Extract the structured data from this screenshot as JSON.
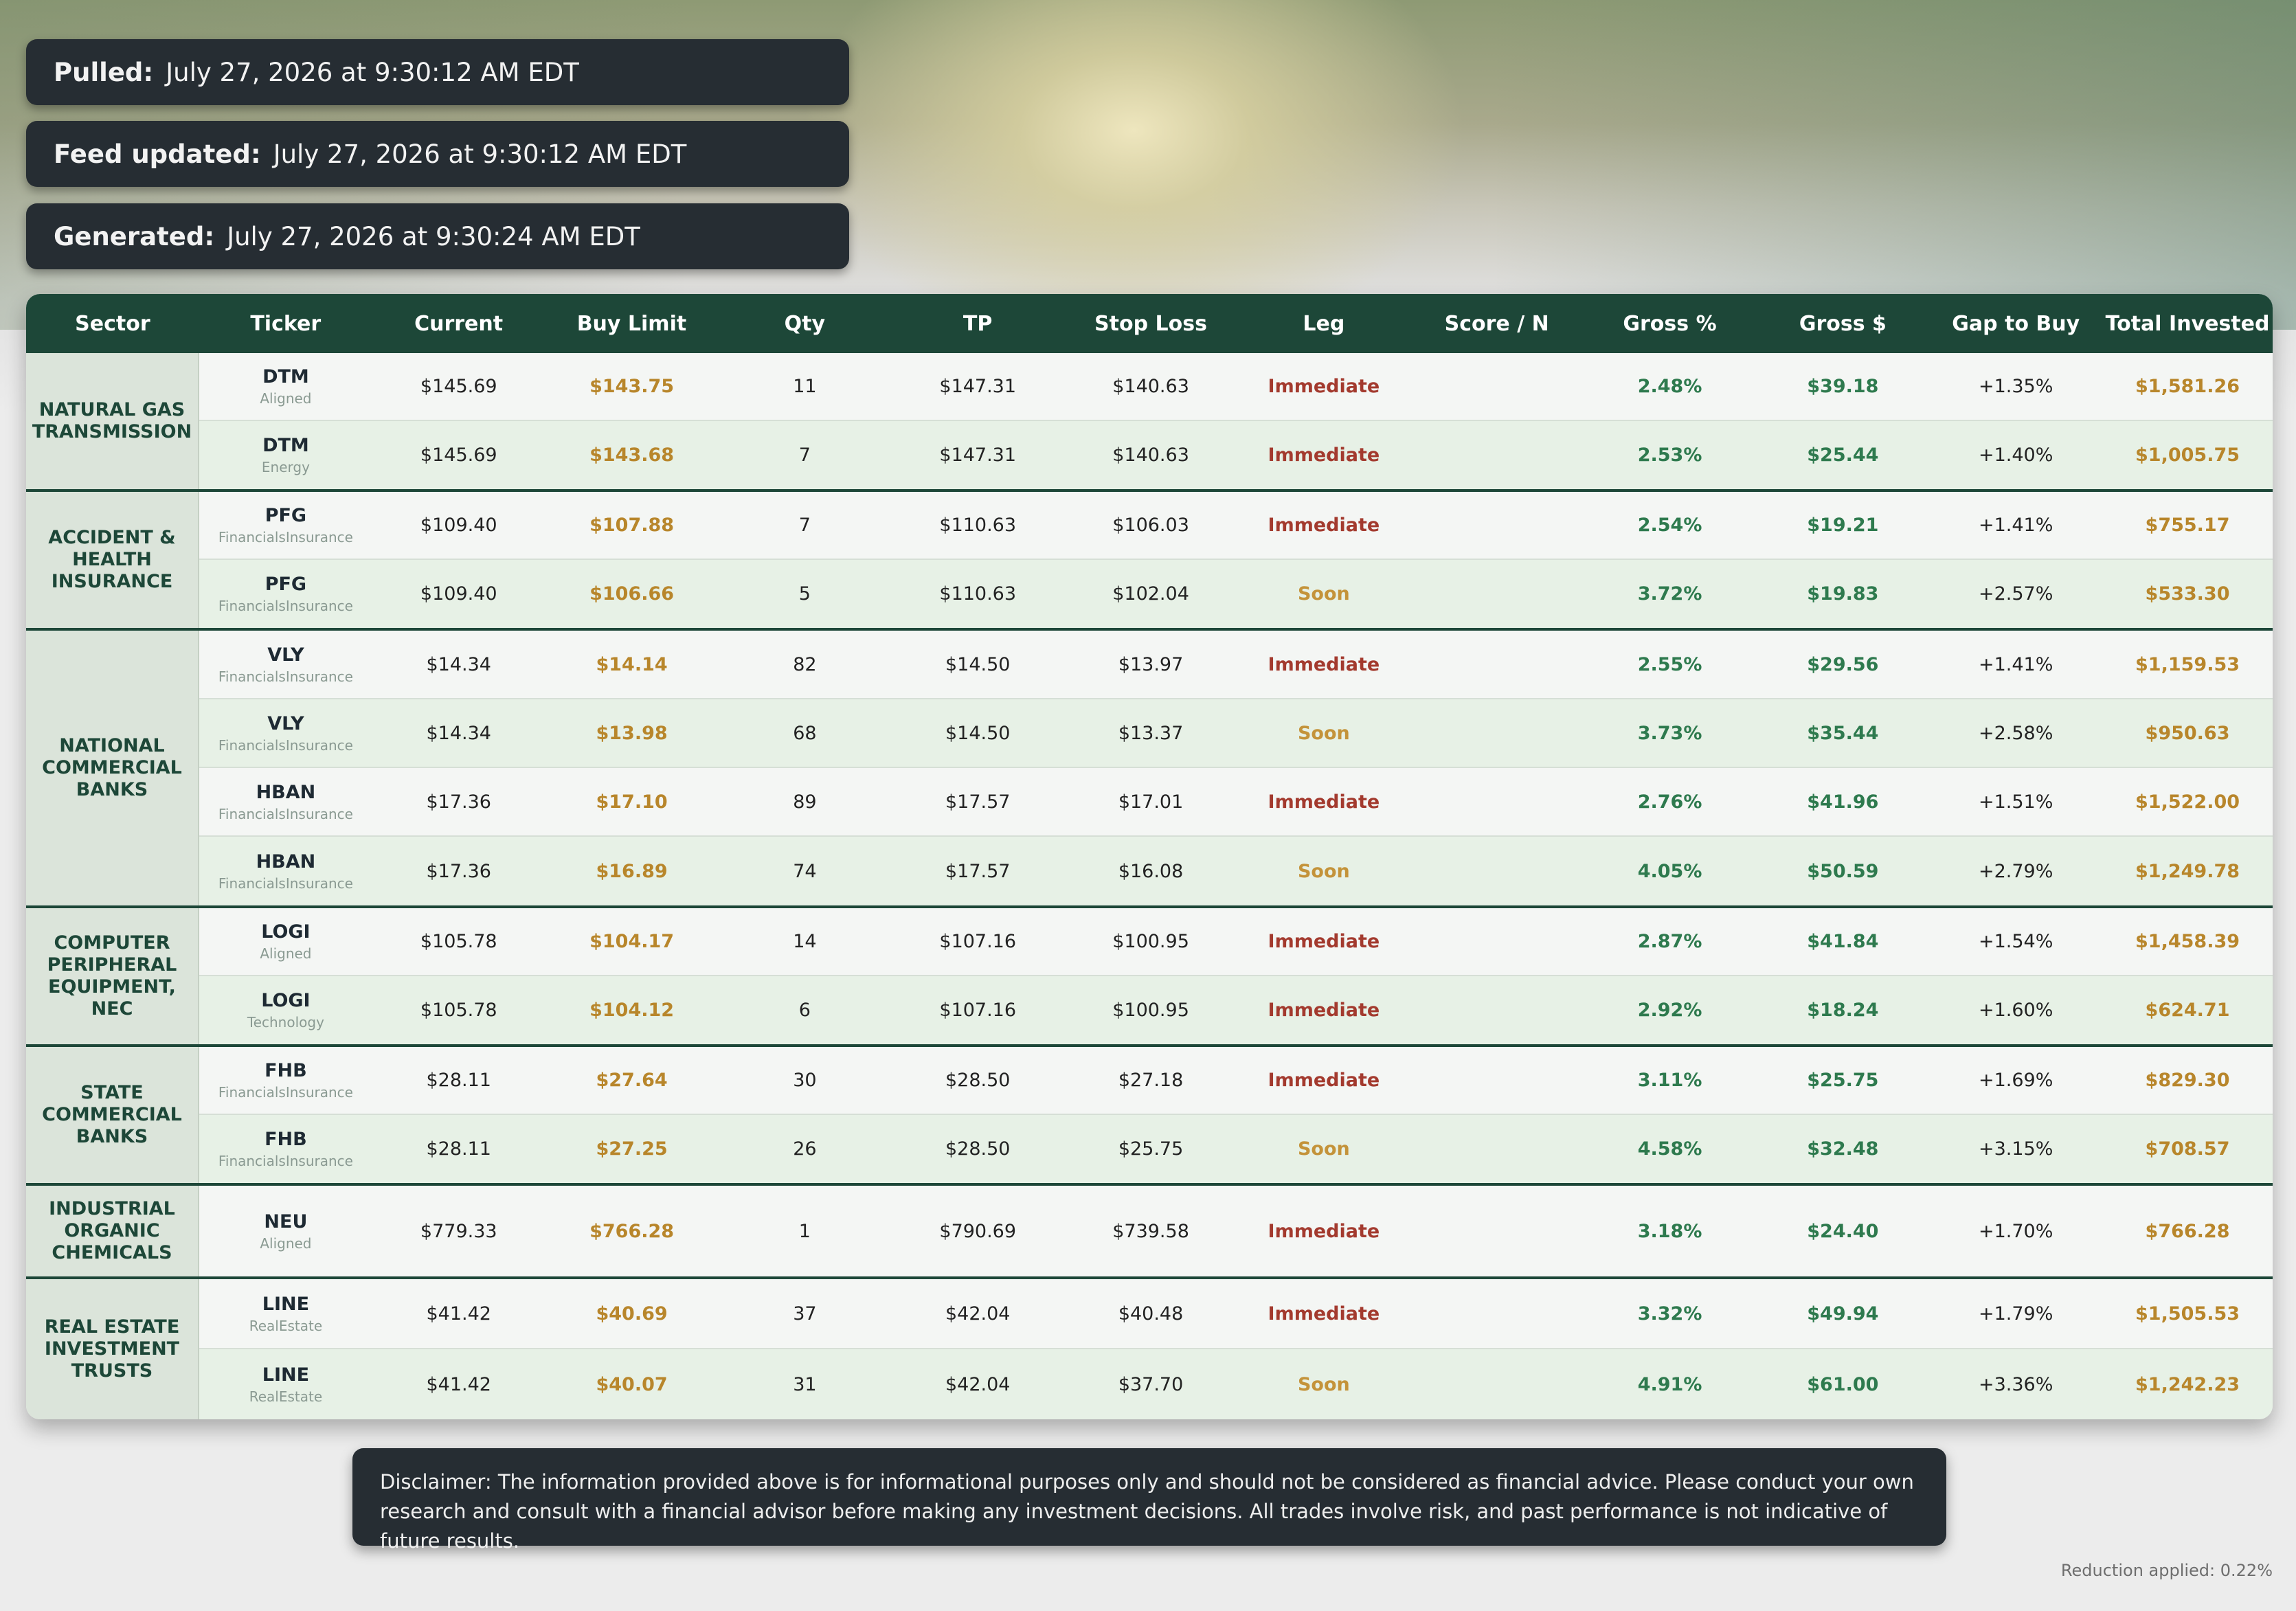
{
  "header": {
    "pulled_label": "Pulled:",
    "pulled_value": "July 27, 2026 at 9:30:12 AM EDT",
    "feed_label": "Feed updated:",
    "feed_value": "July 27, 2026 at 9:30:12 AM EDT",
    "generated_label": "Generated:",
    "generated_value": "July 27, 2026 at 9:30:24 AM EDT"
  },
  "table": {
    "columns": [
      "Sector",
      "Ticker",
      "Current",
      "Buy Limit",
      "Qty",
      "TP",
      "Stop Loss",
      "Leg",
      "Score / N",
      "Gross %",
      "Gross $",
      "Gap to Buy",
      "Total Invested"
    ],
    "groups": [
      {
        "sector": "NATURAL GAS TRANSMISSION",
        "rows": [
          {
            "ticker": "DTM",
            "sub": "Aligned",
            "current": "$145.69",
            "buy_limit": "$143.75",
            "qty": "11",
            "tp": "$147.31",
            "stop_loss": "$140.63",
            "leg": "Immediate",
            "score": "",
            "gross_pct": "2.48%",
            "gross_usd": "$39.18",
            "gap": "+1.35%",
            "total": "$1,581.26"
          },
          {
            "ticker": "DTM",
            "sub": "Energy",
            "current": "$145.69",
            "buy_limit": "$143.68",
            "qty": "7",
            "tp": "$147.31",
            "stop_loss": "$140.63",
            "leg": "Immediate",
            "score": "",
            "gross_pct": "2.53%",
            "gross_usd": "$25.44",
            "gap": "+1.40%",
            "total": "$1,005.75"
          }
        ]
      },
      {
        "sector": "ACCIDENT & HEALTH INSURANCE",
        "rows": [
          {
            "ticker": "PFG",
            "sub": "FinancialsInsurance",
            "current": "$109.40",
            "buy_limit": "$107.88",
            "qty": "7",
            "tp": "$110.63",
            "stop_loss": "$106.03",
            "leg": "Immediate",
            "score": "",
            "gross_pct": "2.54%",
            "gross_usd": "$19.21",
            "gap": "+1.41%",
            "total": "$755.17"
          },
          {
            "ticker": "PFG",
            "sub": "FinancialsInsurance",
            "current": "$109.40",
            "buy_limit": "$106.66",
            "qty": "5",
            "tp": "$110.63",
            "stop_loss": "$102.04",
            "leg": "Soon",
            "score": "",
            "gross_pct": "3.72%",
            "gross_usd": "$19.83",
            "gap": "+2.57%",
            "total": "$533.30"
          }
        ]
      },
      {
        "sector": "NATIONAL COMMERCIAL BANKS",
        "rows": [
          {
            "ticker": "VLY",
            "sub": "FinancialsInsurance",
            "current": "$14.34",
            "buy_limit": "$14.14",
            "qty": "82",
            "tp": "$14.50",
            "stop_loss": "$13.97",
            "leg": "Immediate",
            "score": "",
            "gross_pct": "2.55%",
            "gross_usd": "$29.56",
            "gap": "+1.41%",
            "total": "$1,159.53"
          },
          {
            "ticker": "VLY",
            "sub": "FinancialsInsurance",
            "current": "$14.34",
            "buy_limit": "$13.98",
            "qty": "68",
            "tp": "$14.50",
            "stop_loss": "$13.37",
            "leg": "Soon",
            "score": "",
            "gross_pct": "3.73%",
            "gross_usd": "$35.44",
            "gap": "+2.58%",
            "total": "$950.63"
          },
          {
            "ticker": "HBAN",
            "sub": "FinancialsInsurance",
            "current": "$17.36",
            "buy_limit": "$17.10",
            "qty": "89",
            "tp": "$17.57",
            "stop_loss": "$17.01",
            "leg": "Immediate",
            "score": "",
            "gross_pct": "2.76%",
            "gross_usd": "$41.96",
            "gap": "+1.51%",
            "total": "$1,522.00"
          },
          {
            "ticker": "HBAN",
            "sub": "FinancialsInsurance",
            "current": "$17.36",
            "buy_limit": "$16.89",
            "qty": "74",
            "tp": "$17.57",
            "stop_loss": "$16.08",
            "leg": "Soon",
            "score": "",
            "gross_pct": "4.05%",
            "gross_usd": "$50.59",
            "gap": "+2.79%",
            "total": "$1,249.78"
          }
        ]
      },
      {
        "sector": "COMPUTER PERIPHERAL EQUIPMENT, NEC",
        "rows": [
          {
            "ticker": "LOGI",
            "sub": "Aligned",
            "current": "$105.78",
            "buy_limit": "$104.17",
            "qty": "14",
            "tp": "$107.16",
            "stop_loss": "$100.95",
            "leg": "Immediate",
            "score": "",
            "gross_pct": "2.87%",
            "gross_usd": "$41.84",
            "gap": "+1.54%",
            "total": "$1,458.39"
          },
          {
            "ticker": "LOGI",
            "sub": "Technology",
            "current": "$105.78",
            "buy_limit": "$104.12",
            "qty": "6",
            "tp": "$107.16",
            "stop_loss": "$100.95",
            "leg": "Immediate",
            "score": "",
            "gross_pct": "2.92%",
            "gross_usd": "$18.24",
            "gap": "+1.60%",
            "total": "$624.71"
          }
        ]
      },
      {
        "sector": "STATE COMMERCIAL BANKS",
        "rows": [
          {
            "ticker": "FHB",
            "sub": "FinancialsInsurance",
            "current": "$28.11",
            "buy_limit": "$27.64",
            "qty": "30",
            "tp": "$28.50",
            "stop_loss": "$27.18",
            "leg": "Immediate",
            "score": "",
            "gross_pct": "3.11%",
            "gross_usd": "$25.75",
            "gap": "+1.69%",
            "total": "$829.30"
          },
          {
            "ticker": "FHB",
            "sub": "FinancialsInsurance",
            "current": "$28.11",
            "buy_limit": "$27.25",
            "qty": "26",
            "tp": "$28.50",
            "stop_loss": "$25.75",
            "leg": "Soon",
            "score": "",
            "gross_pct": "4.58%",
            "gross_usd": "$32.48",
            "gap": "+3.15%",
            "total": "$708.57"
          }
        ]
      },
      {
        "sector": "INDUSTRIAL ORGANIC CHEMICALS",
        "rows": [
          {
            "ticker": "NEU",
            "sub": "Aligned",
            "current": "$779.33",
            "buy_limit": "$766.28",
            "qty": "1",
            "tp": "$790.69",
            "stop_loss": "$739.58",
            "leg": "Immediate",
            "score": "",
            "gross_pct": "3.18%",
            "gross_usd": "$24.40",
            "gap": "+1.70%",
            "total": "$766.28"
          }
        ]
      },
      {
        "sector": "REAL ESTATE INVESTMENT TRUSTS",
        "rows": [
          {
            "ticker": "LINE",
            "sub": "RealEstate",
            "current": "$41.42",
            "buy_limit": "$40.69",
            "qty": "37",
            "tp": "$42.04",
            "stop_loss": "$40.48",
            "leg": "Immediate",
            "score": "",
            "gross_pct": "3.32%",
            "gross_usd": "$49.94",
            "gap": "+1.79%",
            "total": "$1,505.53"
          },
          {
            "ticker": "LINE",
            "sub": "RealEstate",
            "current": "$41.42",
            "buy_limit": "$40.07",
            "qty": "31",
            "tp": "$42.04",
            "stop_loss": "$37.70",
            "leg": "Soon",
            "score": "",
            "gross_pct": "4.91%",
            "gross_usd": "$61.00",
            "gap": "+3.36%",
            "total": "$1,242.23"
          }
        ]
      }
    ]
  },
  "disclaimer": "Disclaimer: The information provided above is for informational purposes only and should not be considered as financial advice. Please conduct your own research and consult with a financial advisor before making any investment decisions. All trades involve risk, and past performance is not indicative of future results.",
  "footer": {
    "reduction": "Reduction applied: 0.22%"
  },
  "colors": {
    "header_bg": "#1d4738",
    "info_box_bg": "#262d33",
    "buy_limit": "#b8862b",
    "leg_immediate": "#a33a2e",
    "leg_soon": "#c4933a",
    "gross_green": "#2e7a4e"
  }
}
